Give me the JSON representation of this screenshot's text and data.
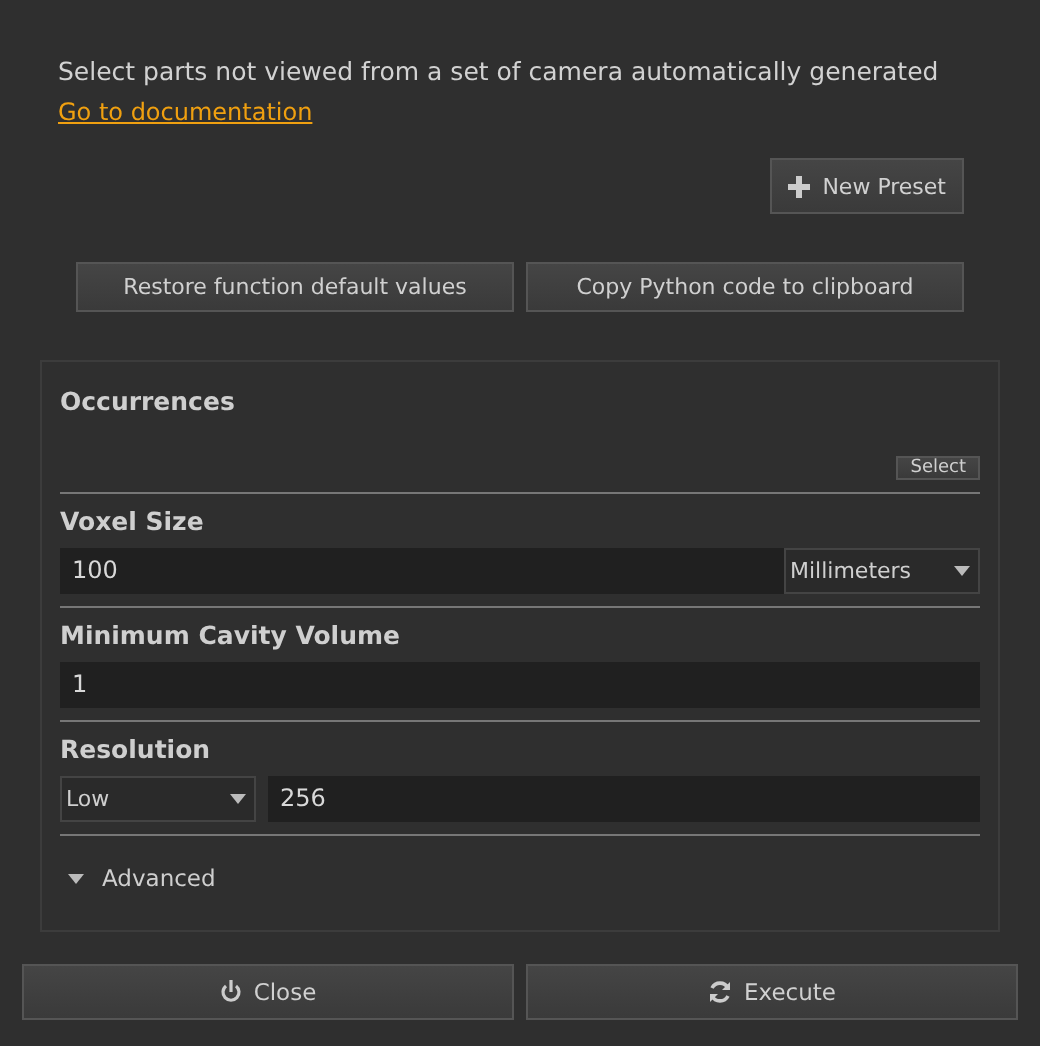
{
  "description": "Select parts not viewed from a set of camera automatically generated",
  "doc_link": "Go to documentation",
  "preset_button": "New Preset",
  "tool_buttons": [
    "Restore function default values",
    "Copy Python code to clipboard"
  ],
  "sections": [
    {
      "kind": "selector",
      "label": "Occurrences",
      "button": "Select"
    },
    {
      "kind": "number_unit",
      "label": "Voxel Size",
      "value": "100",
      "unit": "Millimeters"
    },
    {
      "kind": "number",
      "label": "Minimum Cavity Volume",
      "value": "1"
    },
    {
      "kind": "preset_number",
      "label": "Resolution",
      "preset": "Low",
      "value": "256"
    }
  ],
  "advanced": {
    "label": "Advanced",
    "expanded": false
  },
  "footer": [
    {
      "kind": "close",
      "label": "Close"
    },
    {
      "kind": "execute",
      "label": "Execute"
    }
  ]
}
